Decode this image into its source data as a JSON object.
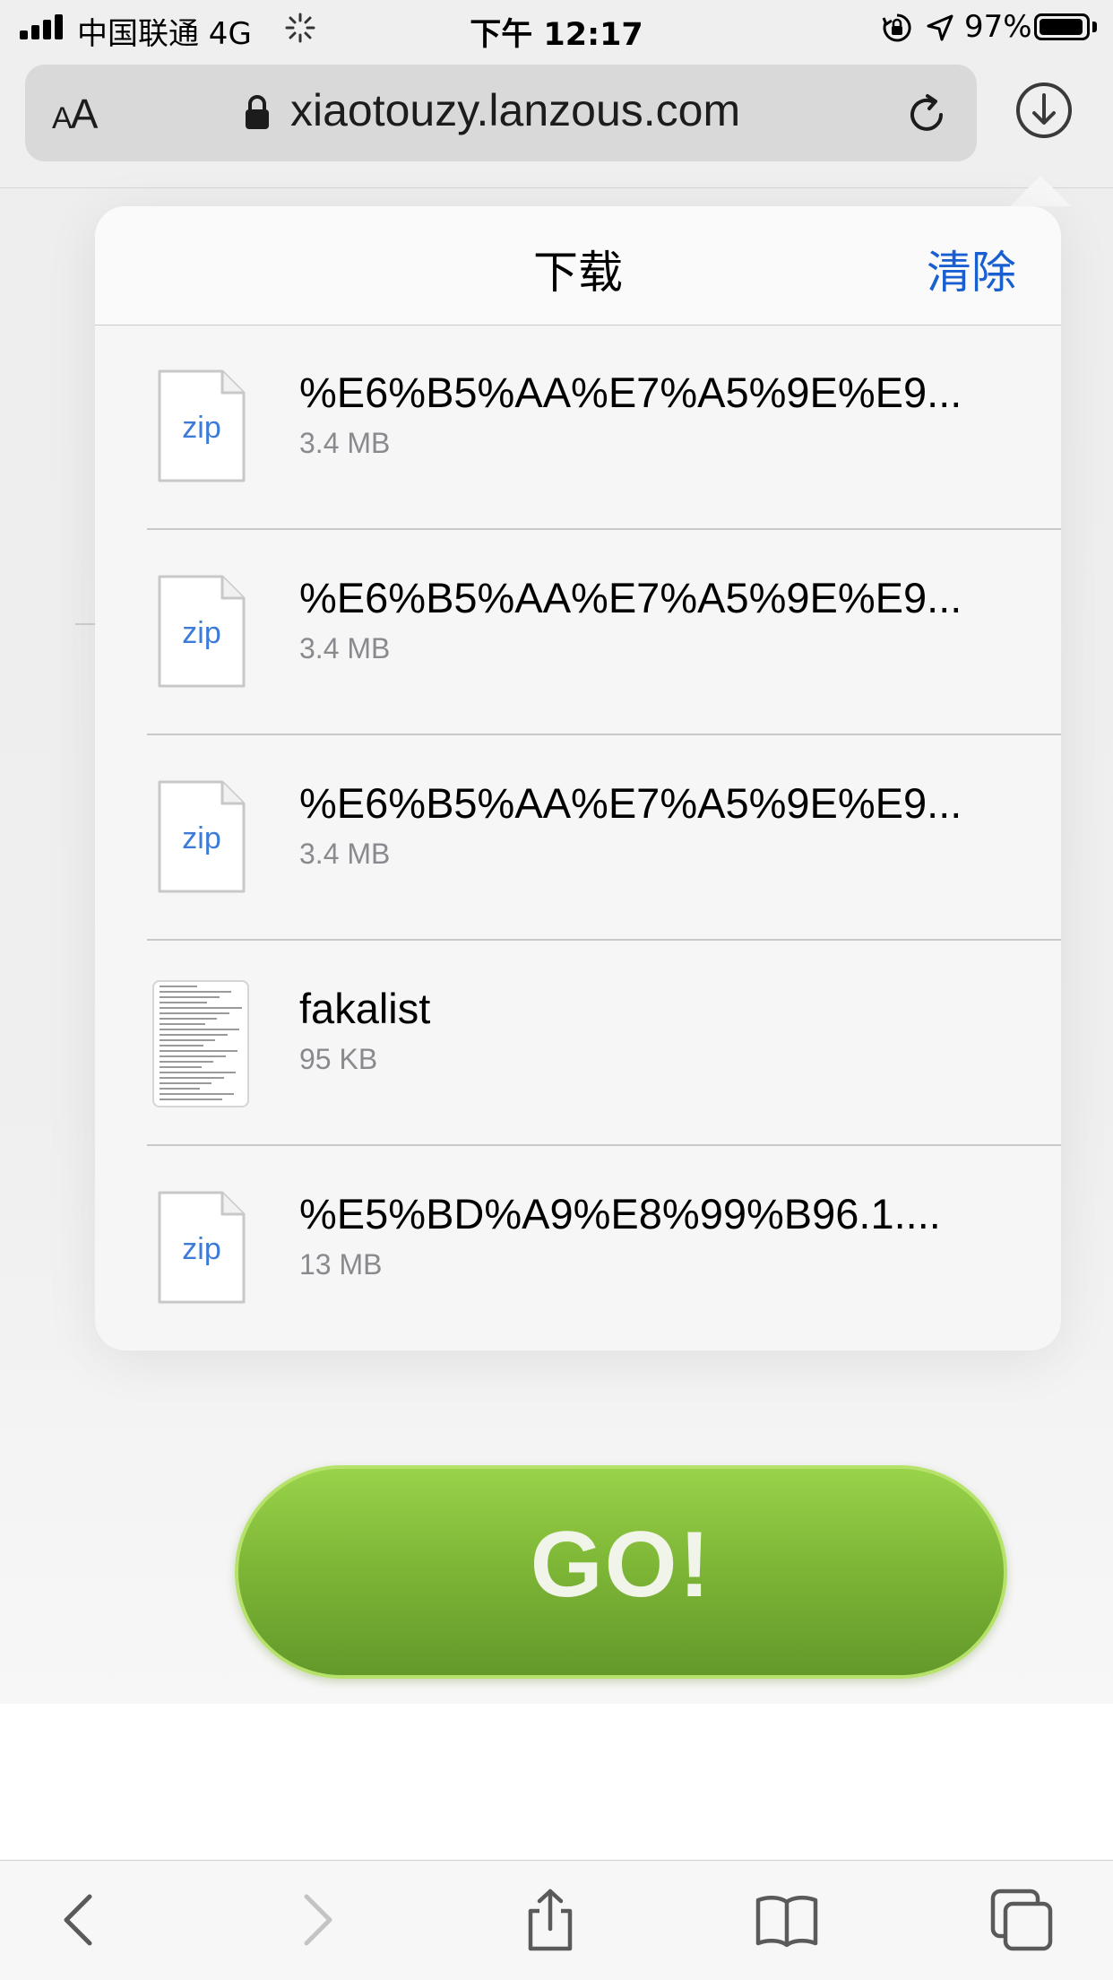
{
  "status_bar": {
    "carrier": "中国联通  4G",
    "time": "下午 12:17",
    "battery_text": "97%",
    "battery_level": 0.97
  },
  "toolbar": {
    "aa_label": "AA",
    "url": "xiaotouzy.lanzous.com"
  },
  "downloads": {
    "title": "下载",
    "clear_label": "清除",
    "items": [
      {
        "name": "%E6%B5%AA%E7%A5%9E%E9...",
        "size": "3.4 MB",
        "icon": "zip",
        "icon_label": "zip"
      },
      {
        "name": "%E6%B5%AA%E7%A5%9E%E9...",
        "size": "3.4 MB",
        "icon": "zip",
        "icon_label": "zip"
      },
      {
        "name": "%E6%B5%AA%E7%A5%9E%E9...",
        "size": "3.4 MB",
        "icon": "zip",
        "icon_label": "zip"
      },
      {
        "name": "fakalist",
        "size": "95 KB",
        "icon": "text-document",
        "icon_label": ""
      },
      {
        "name": "%E5%BD%A9%E8%99%B96.1....",
        "size": "13 MB",
        "icon": "zip",
        "icon_label": "zip"
      }
    ]
  },
  "page": {
    "go_label": "GO!"
  },
  "colors": {
    "accent_blue": "#1a5fd0",
    "zip_label": "#3d7bd9",
    "go_green": "#7fb737"
  }
}
